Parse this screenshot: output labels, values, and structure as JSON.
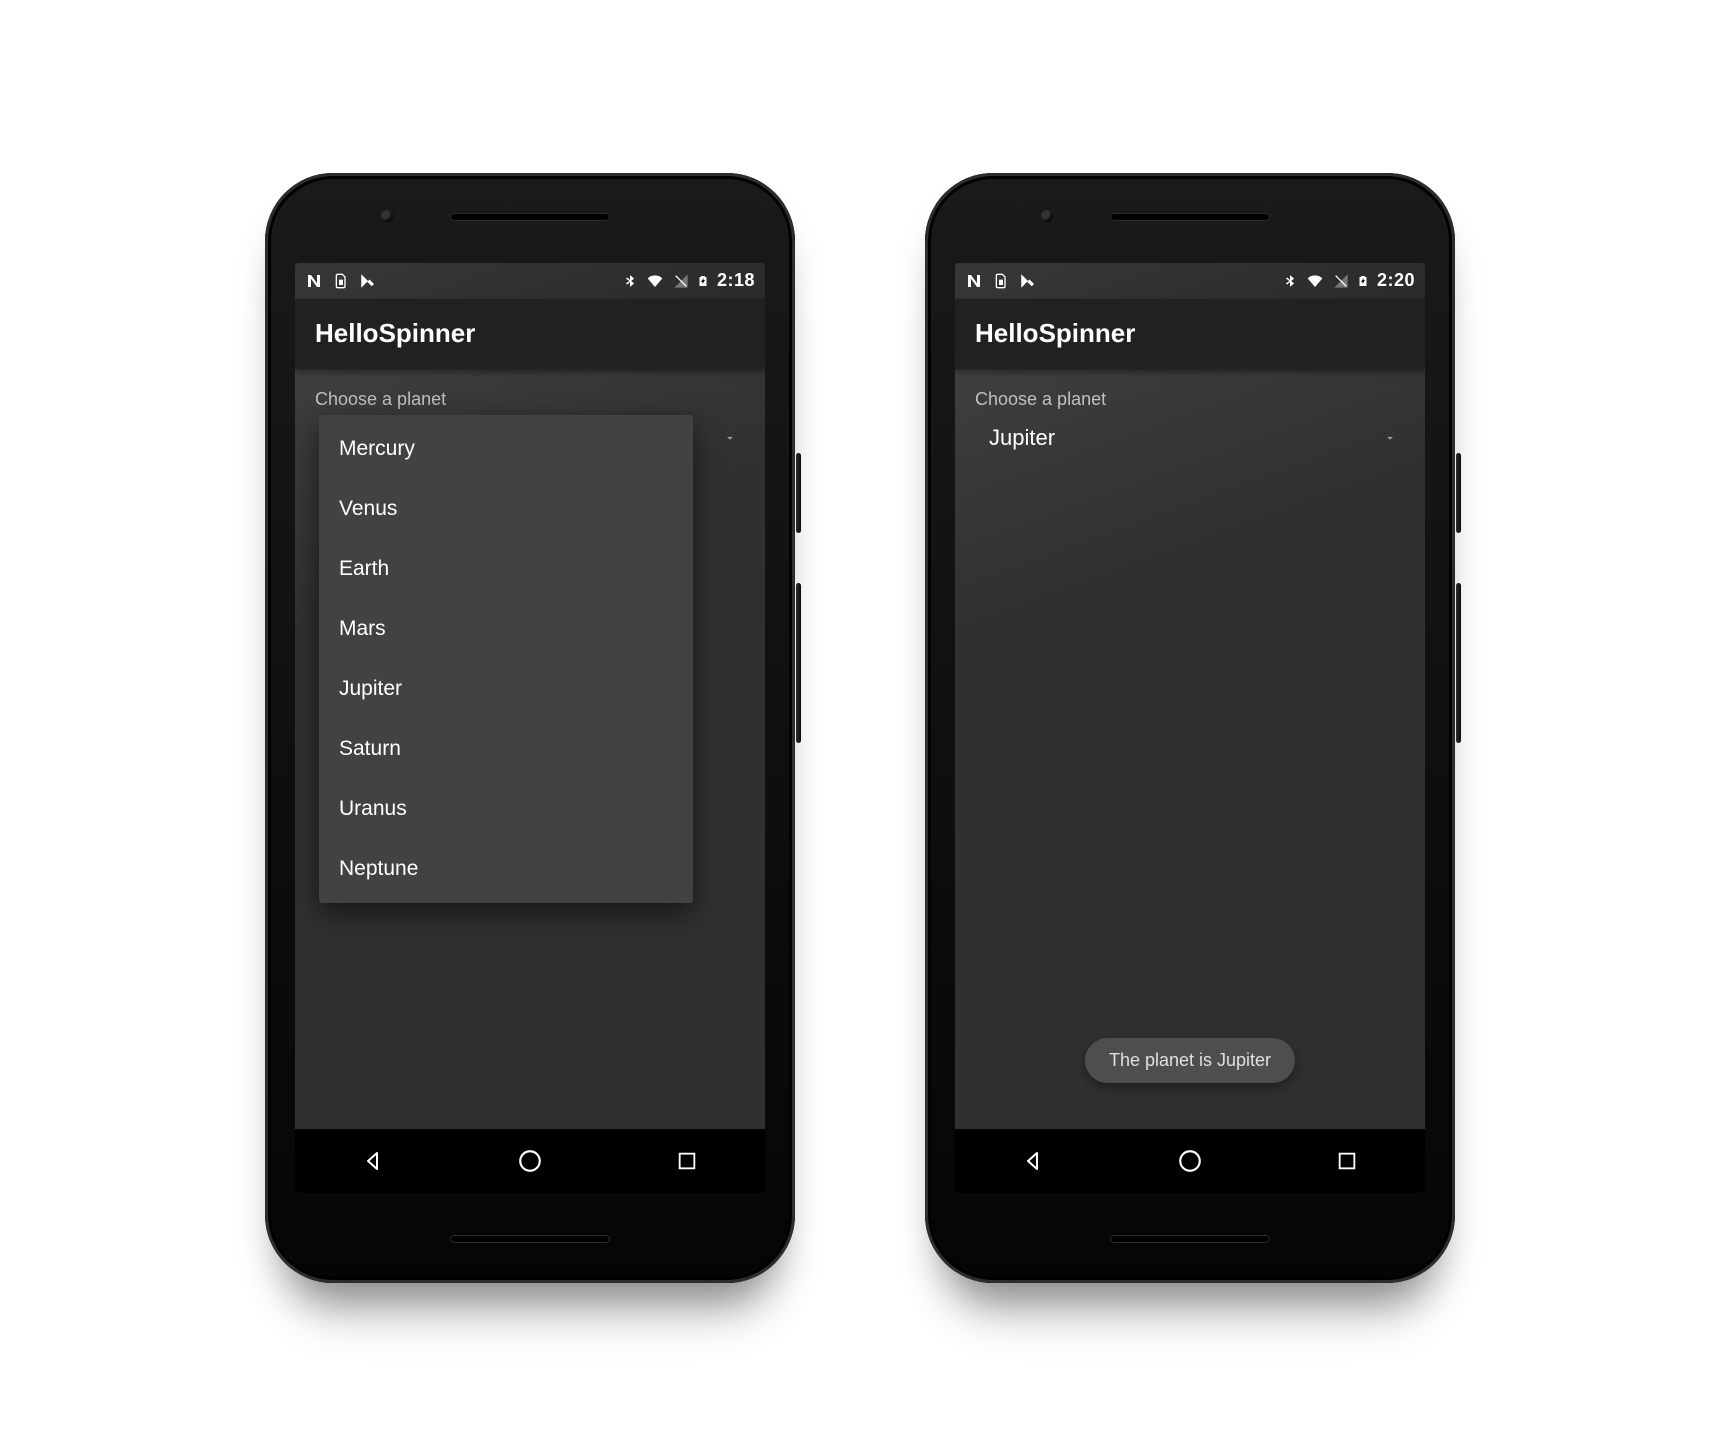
{
  "left": {
    "status": {
      "time": "2:18",
      "icons": {
        "n": "android-n-icon",
        "sim": "sim-icon",
        "debug": "debug-icon",
        "bt": "bluetooth-icon",
        "wifi": "wifi-icon",
        "cell": "cell-icon",
        "batt": "battery-charging-icon"
      }
    },
    "appbar_title": "HelloSpinner",
    "label": "Choose a planet",
    "spinner": {
      "selected": "Mercury",
      "options": [
        "Mercury",
        "Venus",
        "Earth",
        "Mars",
        "Jupiter",
        "Saturn",
        "Uranus",
        "Neptune"
      ]
    }
  },
  "right": {
    "status": {
      "time": "2:20",
      "icons": {
        "n": "android-n-icon",
        "sim": "sim-icon",
        "debug": "debug-icon",
        "bt": "bluetooth-icon",
        "wifi": "wifi-icon",
        "cell": "cell-icon",
        "batt": "battery-charging-icon"
      }
    },
    "appbar_title": "HelloSpinner",
    "label": "Choose a planet",
    "spinner": {
      "selected": "Jupiter"
    },
    "toast": "The planet is Jupiter"
  }
}
